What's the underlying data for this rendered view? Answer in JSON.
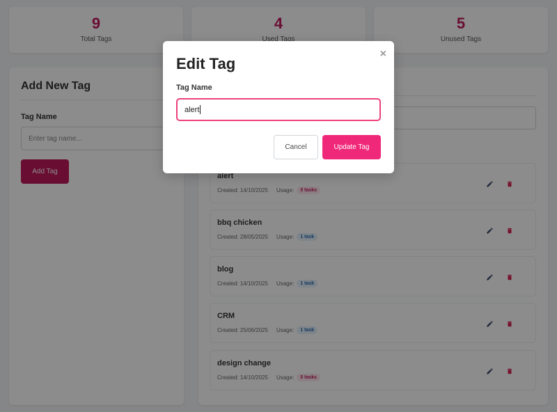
{
  "stats": [
    {
      "value": "9",
      "label": "Total Tags"
    },
    {
      "value": "4",
      "label": "Used Tags"
    },
    {
      "value": "5",
      "label": "Unused Tags"
    }
  ],
  "add_panel": {
    "title": "Add New Tag",
    "field_label": "Tag Name",
    "input_placeholder": "Enter tag name...",
    "button_label": "Add Tag"
  },
  "tags": [
    {
      "name": "alert",
      "created": "Created: 14/10/2025",
      "usage_label": "Usage:",
      "usage": "0 tasks",
      "usage_type": "zero"
    },
    {
      "name": "bbq chicken",
      "created": "Created: 28/05/2025",
      "usage_label": "Usage:",
      "usage": "1 task",
      "usage_type": "one"
    },
    {
      "name": "blog",
      "created": "Created: 14/10/2025",
      "usage_label": "Usage:",
      "usage": "1 task",
      "usage_type": "one"
    },
    {
      "name": "CRM",
      "created": "Created: 25/06/2025",
      "usage_label": "Usage:",
      "usage": "1 task",
      "usage_type": "one"
    },
    {
      "name": "design change",
      "created": "Created: 14/10/2025",
      "usage_label": "Usage:",
      "usage": "0 tasks",
      "usage_type": "zero"
    }
  ],
  "modal": {
    "title": "Edit Tag",
    "close_icon": "×",
    "field_label": "Tag Name",
    "input_value": "alert",
    "cancel_label": "Cancel",
    "update_label": "Update Tag"
  },
  "colors": {
    "accent": "#c2185b",
    "update_button": "#f0287a",
    "input_focus_border": "#ec407a",
    "edit_icon": "#3d4a6b",
    "delete_icon": "#d6204f"
  }
}
